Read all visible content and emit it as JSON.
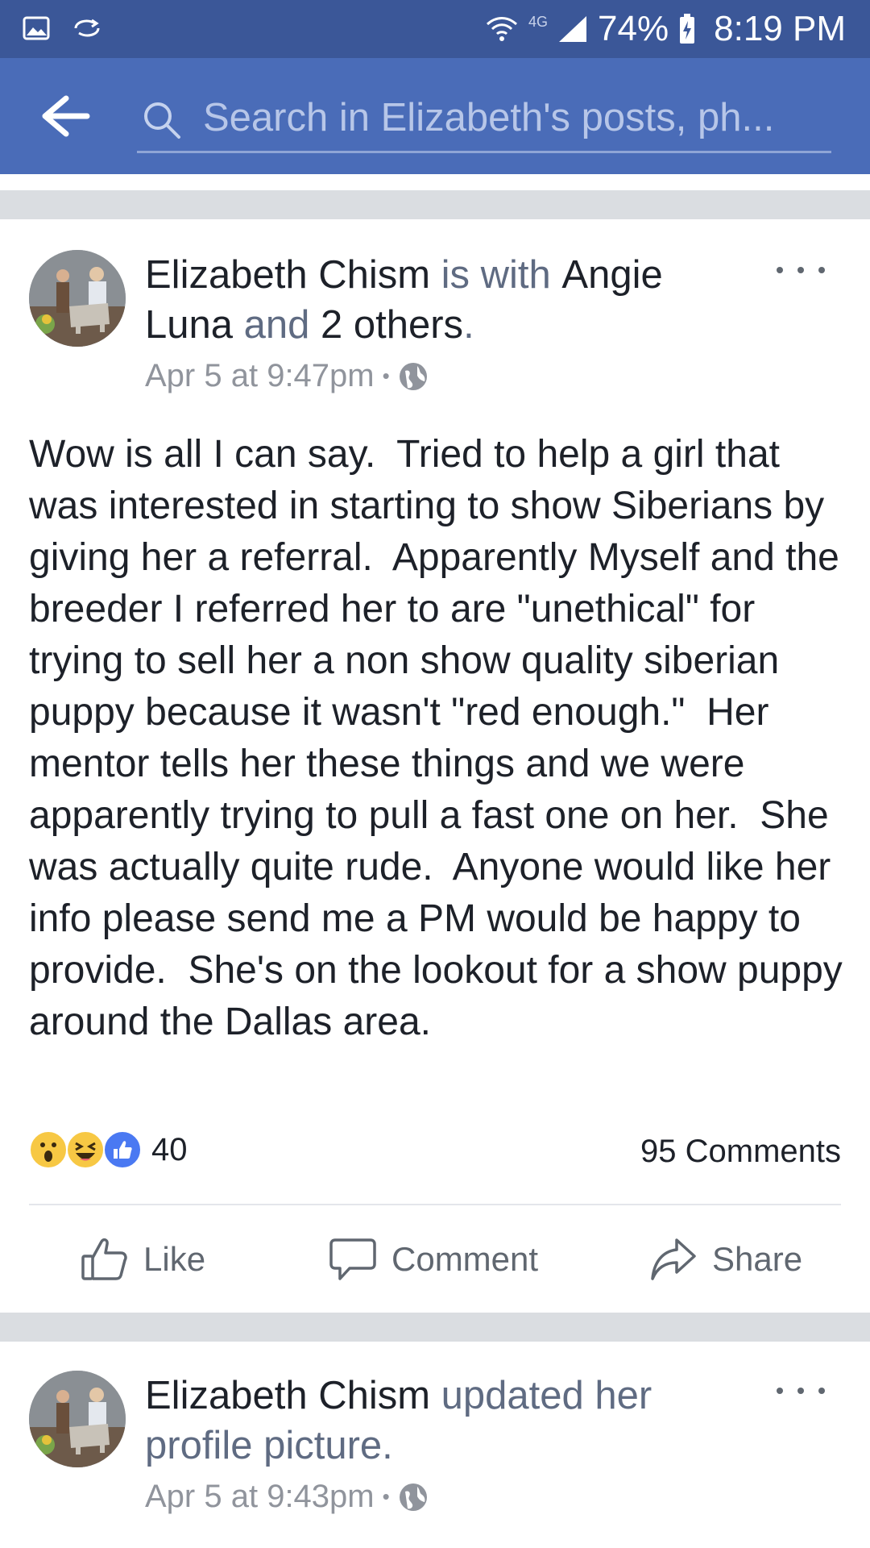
{
  "status_bar": {
    "network": "4G",
    "battery": "74%",
    "time": "8:19 PM"
  },
  "header": {
    "search_placeholder": "Search in Elizabeth's posts, ph..."
  },
  "posts": [
    {
      "author": "Elizabeth Chism",
      "with_text": " is with ",
      "tagged": "Angie Luna",
      "and_text": " and ",
      "others": "2 others",
      "period": ".",
      "timestamp": "Apr 5 at 9:47pm",
      "separator": "•",
      "body": "Wow is all I can say.  Tried to help a girl that was interested in starting to show Siberians by giving her a referral.  Apparently Myself and the breeder I referred her to are \"unethical\" for trying to sell her a non show quality siberian puppy because it wasn't \"red enough.\"  Her mentor tells her these things and we were apparently trying to pull a fast one on her.  She was actually quite rude.  Anyone would like her info please send me a PM would be happy to provide.  She's on the lookout for a show puppy around the Dallas area.",
      "reactions": [
        "wow",
        "haha",
        "like"
      ],
      "reaction_count": "40",
      "comments": "95 Comments",
      "actions": {
        "like": "Like",
        "comment": "Comment",
        "share": "Share"
      }
    },
    {
      "author": "Elizabeth Chism",
      "action_text": " updated her profile picture.",
      "timestamp": "Apr 5 at 9:43pm",
      "separator": "•"
    }
  ],
  "colors": {
    "status_bar": "#3b5798",
    "header": "#4a6cb8",
    "divider": "#dadde1",
    "like_blue": "#4a79f2",
    "reaction_yellow": "#f7c844"
  },
  "icons": [
    "picture-icon",
    "sync-icon",
    "wifi-icon",
    "signal-icon",
    "battery-icon",
    "back-arrow-icon",
    "search-icon",
    "more-icon",
    "globe-icon",
    "thumbs-up-icon",
    "comment-bubble-icon",
    "share-arrow-icon"
  ]
}
